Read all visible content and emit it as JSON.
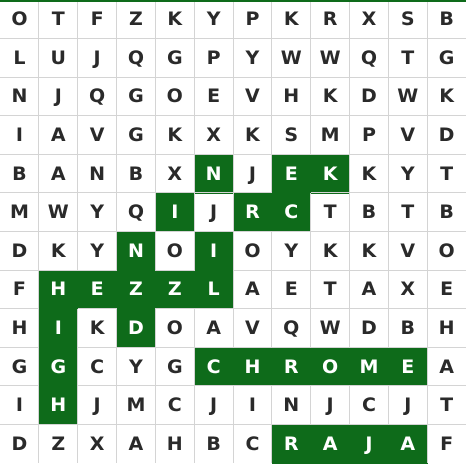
{
  "puzzle": {
    "grid": [
      [
        "O",
        "T",
        "F",
        "Z",
        "K",
        "Y",
        "P",
        "K",
        "R",
        "X",
        "S",
        "B"
      ],
      [
        "L",
        "U",
        "J",
        "Q",
        "G",
        "P",
        "Y",
        "W",
        "W",
        "Q",
        "T",
        "G"
      ],
      [
        "N",
        "J",
        "Q",
        "G",
        "O",
        "E",
        "V",
        "H",
        "K",
        "D",
        "W",
        "K"
      ],
      [
        "I",
        "A",
        "V",
        "G",
        "K",
        "X",
        "K",
        "S",
        "M",
        "P",
        "V",
        "D"
      ],
      [
        "B",
        "A",
        "N",
        "B",
        "X",
        "N",
        "J",
        "E",
        "K",
        "K",
        "Y",
        "T"
      ],
      [
        "M",
        "W",
        "Y",
        "Q",
        "I",
        "J",
        "R",
        "C",
        "T",
        "B",
        "T",
        "B"
      ],
      [
        "D",
        "K",
        "Y",
        "N",
        "O",
        "I",
        "O",
        "Y",
        "K",
        "K",
        "V",
        "O"
      ],
      [
        "F",
        "H",
        "E",
        "Z",
        "Z",
        "L",
        "A",
        "E",
        "T",
        "A",
        "X",
        "E"
      ],
      [
        "H",
        "I",
        "K",
        "D",
        "O",
        "A",
        "V",
        "Q",
        "W",
        "D",
        "B",
        "H"
      ],
      [
        "G",
        "G",
        "C",
        "Y",
        "G",
        "C",
        "H",
        "R",
        "O",
        "M",
        "E",
        "A"
      ],
      [
        "I",
        "H",
        "J",
        "M",
        "C",
        "J",
        "I",
        "N",
        "J",
        "C",
        "J",
        "T"
      ],
      [
        "D",
        "Z",
        "X",
        "A",
        "H",
        "B",
        "C",
        "R",
        "A",
        "J",
        "A",
        "F"
      ]
    ],
    "highlighted_cells": [
      [
        4,
        5
      ],
      [
        4,
        7
      ],
      [
        4,
        8
      ],
      [
        5,
        4
      ],
      [
        5,
        6
      ],
      [
        5,
        7
      ],
      [
        6,
        3
      ],
      [
        6,
        5
      ],
      [
        7,
        1
      ],
      [
        7,
        2
      ],
      [
        7,
        3
      ],
      [
        7,
        4
      ],
      [
        7,
        5
      ],
      [
        8,
        1
      ],
      [
        8,
        3
      ],
      [
        9,
        1
      ],
      [
        9,
        5
      ],
      [
        9,
        6
      ],
      [
        9,
        7
      ],
      [
        9,
        8
      ],
      [
        9,
        9
      ],
      [
        9,
        10
      ],
      [
        10,
        1
      ],
      [
        11,
        7
      ],
      [
        11,
        8
      ],
      [
        11,
        9
      ],
      [
        11,
        10
      ]
    ],
    "highlight_color": "#0e6b1a",
    "text_color": "#2a2a2a",
    "highlight_text_color": "#ffffff",
    "grid_line_color": "#d4d4d4",
    "top_border_color": "#0e6b1a"
  }
}
